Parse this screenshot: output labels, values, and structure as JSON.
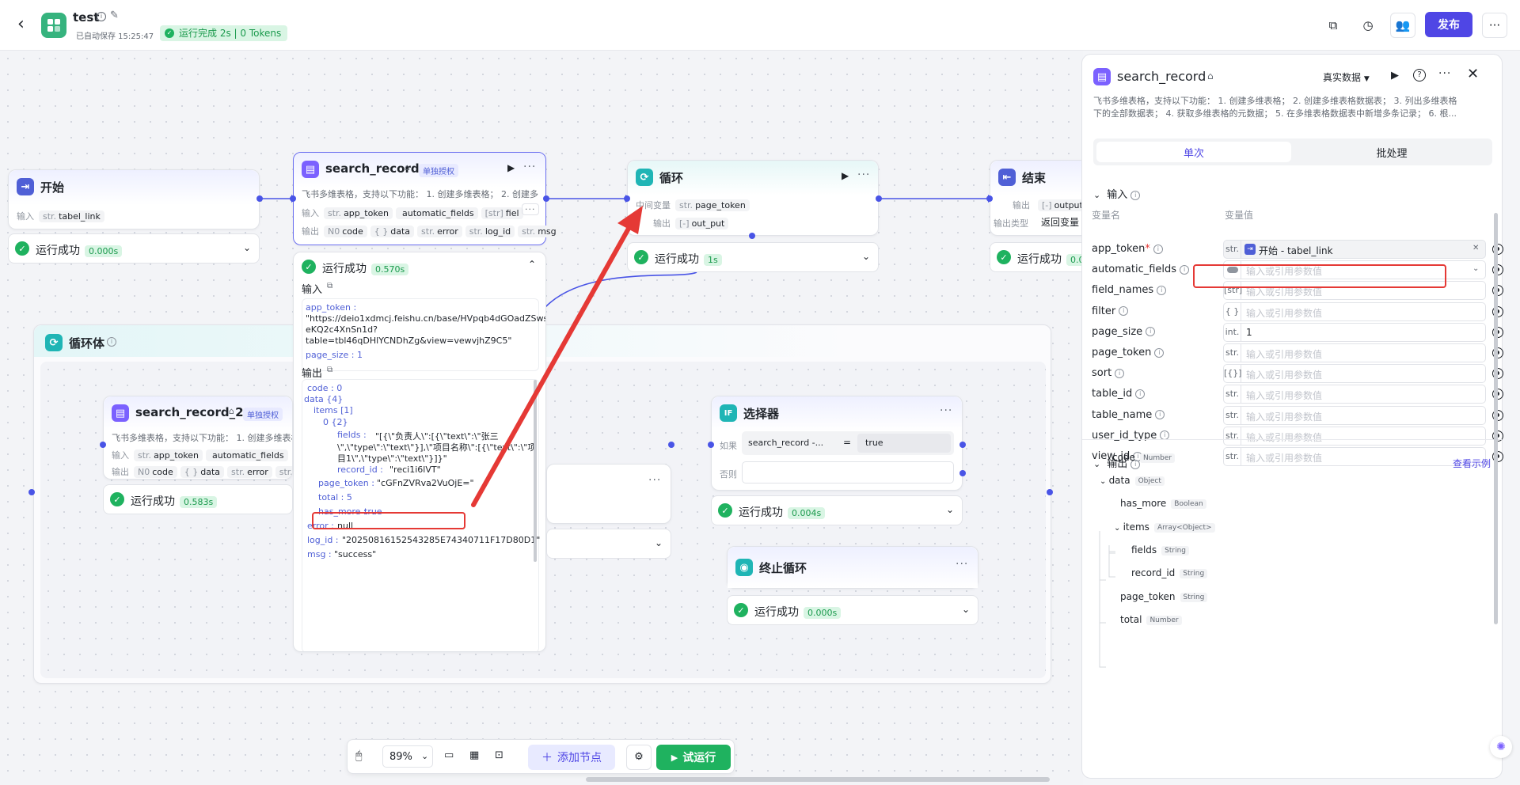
{
  "app": {
    "title": "test",
    "autosave": "已自动保存 15:25:47",
    "run_status": "运行完成 2s | 0 Tokens",
    "publish": "发布",
    "more": "···",
    "back": "‹"
  },
  "colors": {
    "accent": "#4f46e5",
    "success": "#1fb25f",
    "highlight": "#e53935"
  },
  "start": {
    "title": "开始",
    "in_label": "输入",
    "in_type": "str.",
    "in_var": "tabel_link",
    "status": "运行成功",
    "time": "0.000s"
  },
  "sr": {
    "title": "search_record",
    "badge": "单独授权",
    "desc": "飞书多维表格，支持以下功能： 1. 创建多维表格； 2. 创建多...",
    "in_label": "输入",
    "out_label": "输出",
    "in_tags": [
      {
        "t": "str.",
        "n": "app_token"
      },
      {
        "t": "",
        "n": "automatic_fields"
      },
      {
        "t": "[str]",
        "n": "fiel"
      }
    ],
    "out_tags": [
      {
        "t": "N0",
        "n": "code"
      },
      {
        "t": "{ }",
        "n": "data"
      },
      {
        "t": "str.",
        "n": "error"
      },
      {
        "t": "str.",
        "n": "log_id"
      },
      {
        "t": "str.",
        "n": "msg"
      }
    ],
    "status": "运行成功",
    "time": "0.570s"
  },
  "detail": {
    "in_title": "输入",
    "out_title": "输出",
    "app_token_key": "app_token :",
    "app_token_val1": "\"https://deio1xdmcj.feishu.cn/base/HVpqb4dGOadZSws",
    "app_token_val2": "eKQ2c4XnSn1d?",
    "app_token_val3": "table=tbl46qDHlYCNDhZg&view=vewvjhZ9C5\"",
    "page_size": "page_size : 1",
    "code": "code : 0",
    "data": "data {4}",
    "items": "items [1]",
    "zero": "0 {2}",
    "fields_k": "fields :",
    "fields_v1": "\"[{\\\"负责人\\\":[{\\\"text\\\":\\\"张三",
    "fields_v2": "\\\",\\\"type\\\":\\\"text\\\"}],\\\"项目名称\\\":[{\\\"text\\\":\\\"项",
    "fields_v3": "目1\\\",\\\"type\\\":\\\"text\\\"}]}\"",
    "record_k": "record_id :",
    "record_v": "\"reci1i6lVT\"",
    "pt_k": "page_token :",
    "pt_v": "\"cGFnZVRva2VuOjE=\"",
    "total": "total : 5",
    "has_more_k": "has_more :",
    "has_more_v": "true",
    "error_k": "error :",
    "error_v": "null",
    "log_k": "log_id :",
    "log_v": "\"20250816152543285E74340711F17D80D1\"",
    "msg_k": "msg :",
    "msg_v": "\"success\""
  },
  "loop": {
    "title": "循环",
    "mid_label": "中间变量",
    "mid_type": "str.",
    "mid_var": "page_token",
    "out_label": "输出",
    "out_type": "[-]",
    "out_var": "out_put",
    "status": "运行成功",
    "time": "1s"
  },
  "end": {
    "title": "结束",
    "out_label": "输出",
    "out_type": "[-]",
    "out_var": "output",
    "type_label": "输出类型",
    "type_val": "返回变量",
    "status": "运行成功",
    "time": "0.0"
  },
  "loopbody": {
    "title": "循环体"
  },
  "sr2": {
    "title": "search_record_2",
    "badge": "单独授权",
    "desc": "飞书多维表格，支持以下功能： 1. 创建多维表格",
    "in_label": "输入",
    "out_label": "输出",
    "in_tags": [
      {
        "t": "str.",
        "n": "app_token"
      },
      {
        "t": "",
        "n": "automatic_fields"
      }
    ],
    "out_tags": [
      {
        "t": "N0",
        "n": "code"
      },
      {
        "t": "{ }",
        "n": "data"
      },
      {
        "t": "str.",
        "n": "error"
      },
      {
        "t": "str.",
        "n": "log_ic"
      }
    ],
    "status": "运行成功",
    "time": "0.583s"
  },
  "selector": {
    "title": "选择器",
    "if_label": "如果",
    "cond_left": "search_record -...",
    "op": "=",
    "cond_right": "true",
    "else_label": "否则",
    "status": "运行成功",
    "time": "0.004s"
  },
  "stoploop": {
    "title": "终止循环",
    "status": "运行成功",
    "time": "0.000s"
  },
  "toolbar": {
    "zoom": "89%",
    "add_node": "添加节点",
    "test_run": "试运行"
  },
  "panel": {
    "title": "search_record",
    "data_mode": "真实数据",
    "desc1": "飞书多维表格，支持以下功能： 1. 创建多维表格； 2. 创建多维表格数据表； 3. 列出多维表格",
    "desc2": "下的全部数据表； 4. 获取多维表格的元数据； 5. 在多维表格数据表中新增多条记录； 6. 根...",
    "tab_single": "单次",
    "tab_batch": "批处理",
    "input_title": "输入",
    "col_name": "变量名",
    "col_value": "变量值",
    "output_title": "输出",
    "view_example": "查看示例",
    "params": [
      {
        "name": "app_token",
        "req": "*",
        "type": "str.",
        "value": "开始 - tabel_link",
        "ref": true
      },
      {
        "name": "automatic_fields",
        "type": "toggle",
        "value": "输入或引用参数值"
      },
      {
        "name": "field_names",
        "type": "[str]",
        "value": "输入或引用参数值"
      },
      {
        "name": "filter",
        "type": "{ }",
        "value": "输入或引用参数值"
      },
      {
        "name": "page_size",
        "type": "int.",
        "value": "1",
        "filled": true
      },
      {
        "name": "page_token",
        "type": "str.",
        "value": "输入或引用参数值"
      },
      {
        "name": "sort",
        "type": "[{}]",
        "value": "输入或引用参数值"
      },
      {
        "name": "table_id",
        "type": "str.",
        "value": "输入或引用参数值"
      },
      {
        "name": "table_name",
        "type": "str.",
        "value": "输入或引用参数值"
      },
      {
        "name": "user_id_type",
        "type": "str.",
        "value": "输入或引用参数值"
      },
      {
        "name": "view_id",
        "type": "str.",
        "value": "输入或引用参数值"
      }
    ],
    "outputs": [
      {
        "name": "code",
        "type": "Number"
      },
      {
        "name": "data",
        "type": "Object"
      },
      {
        "name": "has_more",
        "type": "Boolean"
      },
      {
        "name": "items",
        "type": "Array<Object>"
      },
      {
        "name": "fields",
        "type": "String"
      },
      {
        "name": "record_id",
        "type": "String"
      },
      {
        "name": "page_token",
        "type": "String"
      },
      {
        "name": "total",
        "type": "Number"
      }
    ]
  }
}
